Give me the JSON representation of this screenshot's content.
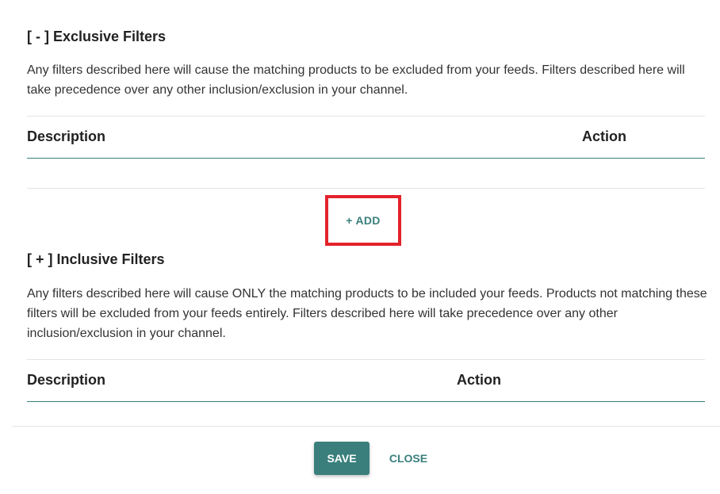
{
  "exclusive": {
    "title": "[ - ] Exclusive Filters",
    "description": "Any filters described here will cause the matching products to be excluded from your feeds. Filters described here will take precedence over any other inclusion/exclusion in your channel.",
    "table": {
      "col_description": "Description",
      "col_action": "Action"
    },
    "add_label": "+ ADD"
  },
  "inclusive": {
    "title": "[ + ] Inclusive Filters",
    "description": "Any filters described here will cause ONLY the matching products to be included your feeds. Products not matching these filters will be excluded from your feeds entirely. Filters described here will take precedence over any other inclusion/exclusion in your channel.",
    "table": {
      "col_description": "Description",
      "col_action": "Action"
    }
  },
  "footer": {
    "save_label": "SAVE",
    "close_label": "CLOSE"
  },
  "colors": {
    "accent": "#3a7f7c",
    "highlight_border": "#e3222a"
  }
}
